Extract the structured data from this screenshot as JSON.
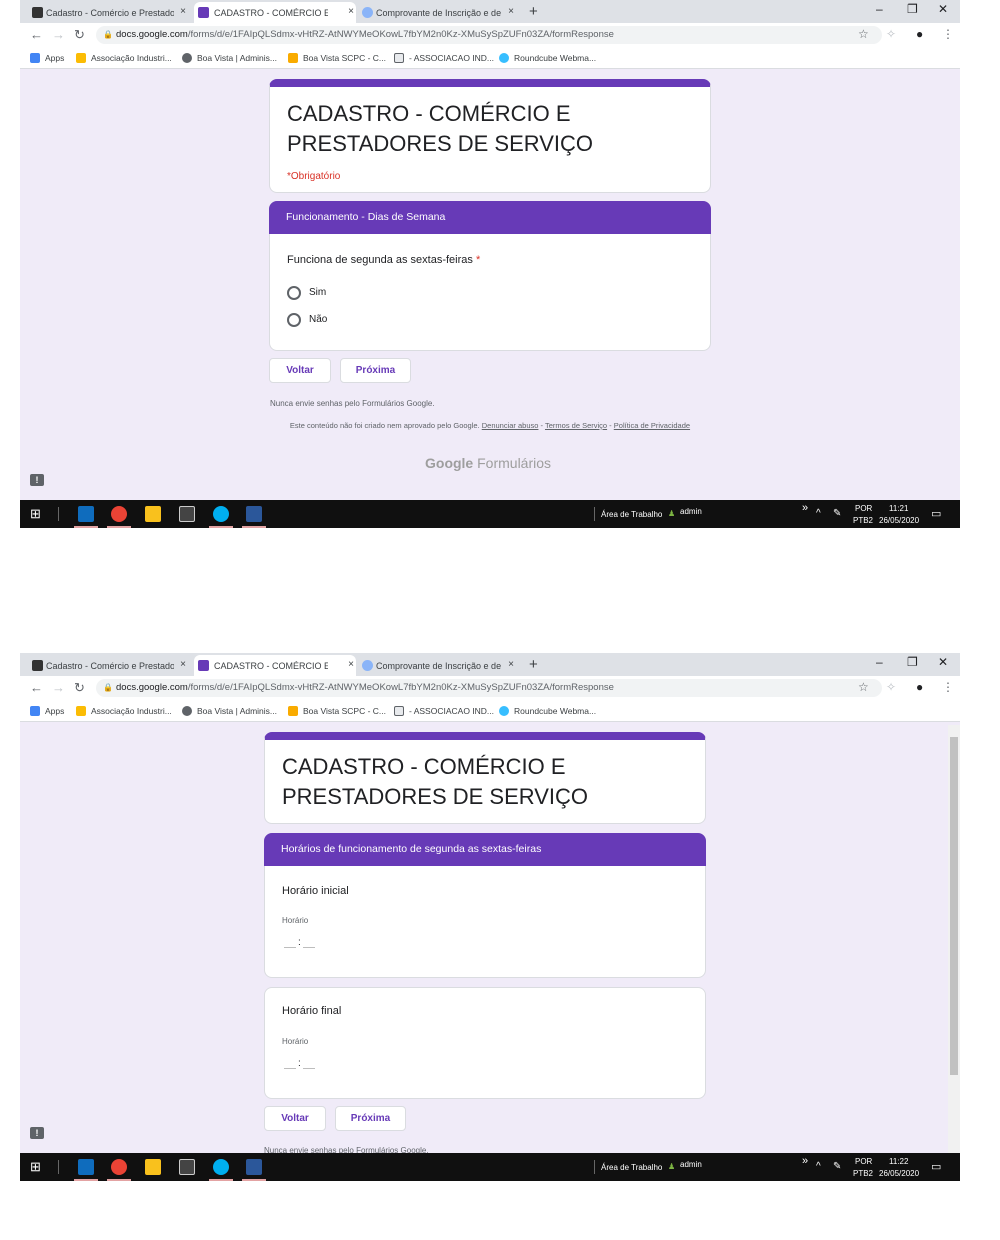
{
  "browser": {
    "tabs": [
      {
        "title": "Cadastro - Comércio e Prestador",
        "favicon": "terminal-icon",
        "active": false
      },
      {
        "title": "CADASTRO - COMÉRCIO E PRES",
        "favicon": "google-forms-icon",
        "active": true
      },
      {
        "title": "Comprovante de Inscrição e de S",
        "favicon": "diamond-icon",
        "active": false
      }
    ],
    "new_tab_label": "+",
    "close_label": "×",
    "win_minimize": "–",
    "win_restore": "❐",
    "win_close": "✕",
    "url_host": "docs.google.com",
    "url_path": "/forms/d/e/1FAIpQLSdmx-vHtRZ-AtNWYMeOKowL7fbYM2n0Kz-XMuSySpZUFn03ZA/formResponse",
    "bookmarks": [
      {
        "label": "Apps",
        "icon": "apps-grid-icon"
      },
      {
        "label": "Associação Industri...",
        "icon": "association-icon"
      },
      {
        "label": "Boa Vista | Adminis...",
        "icon": "globe-icon"
      },
      {
        "label": "Boa Vista SCPC - C...",
        "icon": "folder-icon"
      },
      {
        "label": "- ASSOCIACAO IND...",
        "icon": "feather-icon"
      },
      {
        "label": "Roundcube Webma...",
        "icon": "roundcube-icon"
      }
    ]
  },
  "form": {
    "title": "CADASTRO - COMÉRCIO E PRESTADORES DE SERVIÇO",
    "required_note": "*Obrigatório",
    "back_label": "Voltar",
    "next_label": "Próxima",
    "password_note": "Nunca envie senhas pelo Formulários Google.",
    "disclaimer": "Este conteúdo não foi criado nem aprovado pelo Google.",
    "link_abuse": "Denunciar abuso",
    "link_terms": "Termos de Serviço",
    "link_privacy": "Política de Privacidade",
    "sep": " - ",
    "brand_google": "Google",
    "brand_forms": "Formulários",
    "section1": {
      "header": "Funcionamento - Dias de Semana",
      "question": "Funciona de segunda as sextas-feiras",
      "required_mark": "*",
      "options": [
        "Sim",
        "Não"
      ]
    },
    "section2": {
      "header": "Horários de funcionamento de segunda as sextas-feiras",
      "q1": "Horário inicial",
      "q2": "Horário final",
      "field_label": "Horário",
      "colon": ":"
    }
  },
  "taskbar": {
    "desktop_label": "Área de Trabalho",
    "user": "admin",
    "overflow": "»",
    "lang1": "POR",
    "lang2": "PTB2",
    "time1": "11:21",
    "time2": "11:22",
    "date": "26/05/2020"
  },
  "feedback_label": "!"
}
